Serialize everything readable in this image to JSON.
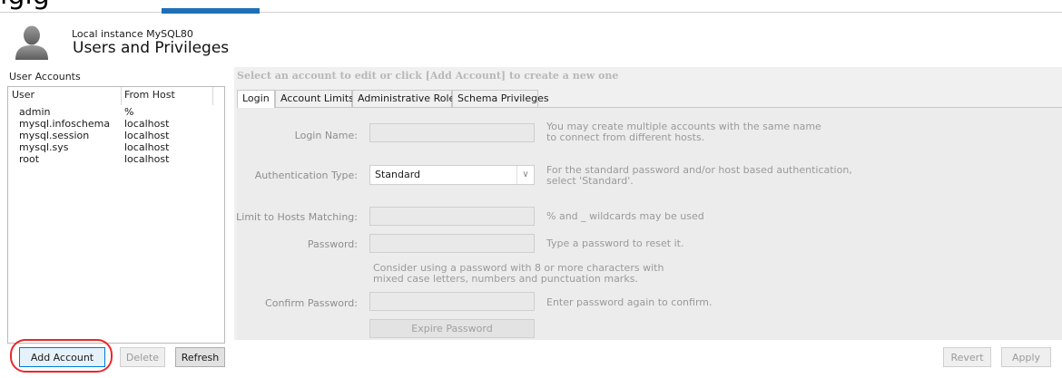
{
  "header": {
    "overflow_title": "igig",
    "instance_label": "Local instance MySQL80",
    "page_title": "Users and Privileges"
  },
  "accounts": {
    "section_label": "User Accounts",
    "col_user": "User",
    "col_host": "From Host",
    "rows": [
      {
        "user": "admin",
        "host": "%"
      },
      {
        "user": "mysql.infoschema",
        "host": "localhost"
      },
      {
        "user": "mysql.session",
        "host": "localhost"
      },
      {
        "user": "mysql.sys",
        "host": "localhost"
      },
      {
        "user": "root",
        "host": "localhost"
      }
    ]
  },
  "buttons": {
    "add_account": "Add Account",
    "delete": "Delete",
    "refresh": "Refresh",
    "revert": "Revert",
    "apply": "Apply",
    "expire_password": "Expire Password"
  },
  "detail": {
    "hint": "Select an account to edit or click [Add Account] to create a new one",
    "tabs": [
      "Login",
      "Account Limits",
      "Administrative Roles",
      "Schema Privileges"
    ],
    "active_tab": "Login",
    "login_name_label": "Login Name:",
    "login_name_value": "",
    "login_name_help_1": "You may create multiple accounts with the same name",
    "login_name_help_2": "to connect from different hosts.",
    "auth_type_label": "Authentication Type:",
    "auth_type_value": "Standard",
    "auth_type_help_1": "For the standard password and/or host based authentication,",
    "auth_type_help_2": "select 'Standard'.",
    "hosts_label": "Limit to Hosts Matching:",
    "hosts_value": "",
    "hosts_help": "% and _ wildcards may be used",
    "password_label": "Password:",
    "password_value": "",
    "password_help": "Type a password to reset it.",
    "password_note_1": "Consider using a password with 8 or more characters with",
    "password_note_2": "mixed case letters, numbers and punctuation marks.",
    "confirm_label": "Confirm Password:",
    "confirm_value": "",
    "confirm_help": "Enter password again to confirm."
  },
  "colors": {
    "accent": "#1f6fb6",
    "highlight_ring": "#e8282b"
  }
}
